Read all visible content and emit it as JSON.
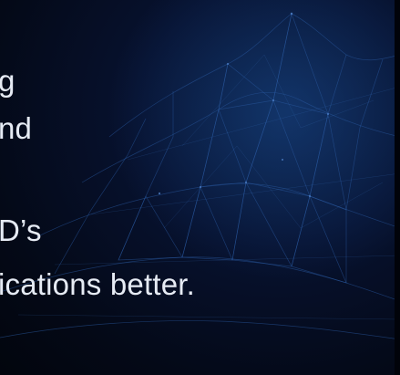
{
  "hero": {
    "lines": [
      "g",
      "nd",
      "D’s",
      "ications better."
    ]
  },
  "colors": {
    "background": "#050a18",
    "mesh_line": "#2a5aa0",
    "text": "#e6ebf4"
  }
}
